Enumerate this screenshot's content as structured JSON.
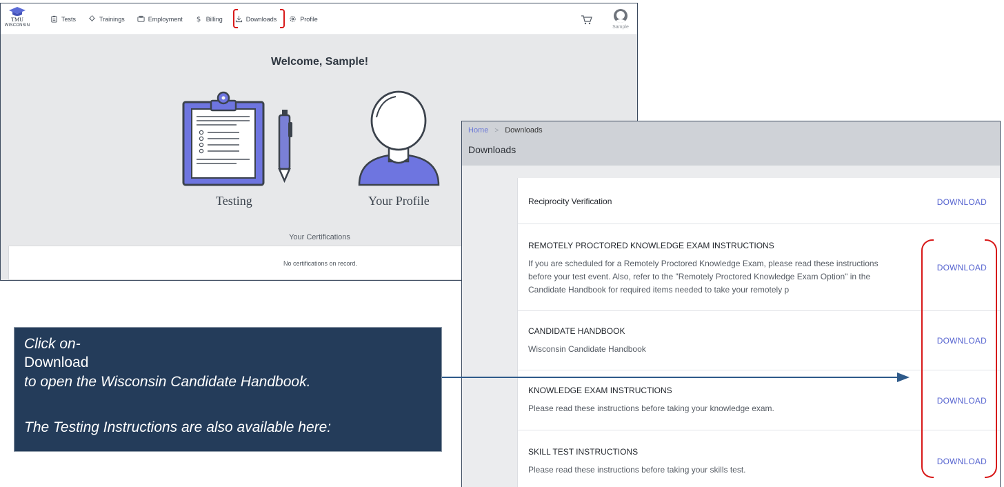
{
  "app": {
    "logo_text": "TMU",
    "logo_sub": "WISCONSIN"
  },
  "topnav": {
    "items": [
      {
        "label": "Tests",
        "icon": "clipboard-icon"
      },
      {
        "label": "Trainings",
        "icon": "lightbulb-icon"
      },
      {
        "label": "Employment",
        "icon": "briefcase-icon"
      },
      {
        "label": "Billing",
        "icon": "dollar-icon"
      },
      {
        "label": "Downloads",
        "icon": "download-icon"
      },
      {
        "label": "Profile",
        "icon": "gear-icon"
      }
    ],
    "user_name": "Sample",
    "highlight_color": "#d81818"
  },
  "dashboard": {
    "welcome": "Welcome, Sample!",
    "cards": [
      {
        "label": "Testing",
        "icon": "clipboard-pen-icon"
      },
      {
        "label": "Your Profile",
        "icon": "person-icon"
      }
    ],
    "certifications_title": "Your Certifications",
    "certifications_empty": "No certifications on record."
  },
  "downloads_page": {
    "breadcrumb": [
      "Home",
      "Downloads"
    ],
    "title": "Downloads",
    "items": [
      {
        "title": "Reciprocity Verification",
        "description": "",
        "action": "DOWNLOAD"
      },
      {
        "title": "REMOTELY PROCTORED KNOWLEDGE EXAM INSTRUCTIONS",
        "description": "If you are scheduled for a Remotely Proctored Knowledge Exam, please read these instructions before your test event. Also, refer to the \"Remotely Proctored Knowledge Exam Option\" in the Candidate Handbook for required items needed to take your remotely p",
        "action": "DOWNLOAD"
      },
      {
        "title": "CANDIDATE HANDBOOK",
        "description": "Wisconsin Candidate Handbook",
        "action": "DOWNLOAD"
      },
      {
        "title": "KNOWLEDGE EXAM INSTRUCTIONS",
        "description": "Please read these instructions before taking your knowledge exam.",
        "action": "DOWNLOAD"
      },
      {
        "title": "SKILL TEST INSTRUCTIONS",
        "description": "Please read these instructions before taking your skills test.",
        "action": "DOWNLOAD"
      }
    ],
    "accent_color": "#5664d0"
  },
  "callout": {
    "line1": "Click on-",
    "line2": "Download",
    "line3": "to open the Wisconsin Candidate Handbook.",
    "line4": "The Testing Instructions are also available here:",
    "background": "#243c5a"
  }
}
